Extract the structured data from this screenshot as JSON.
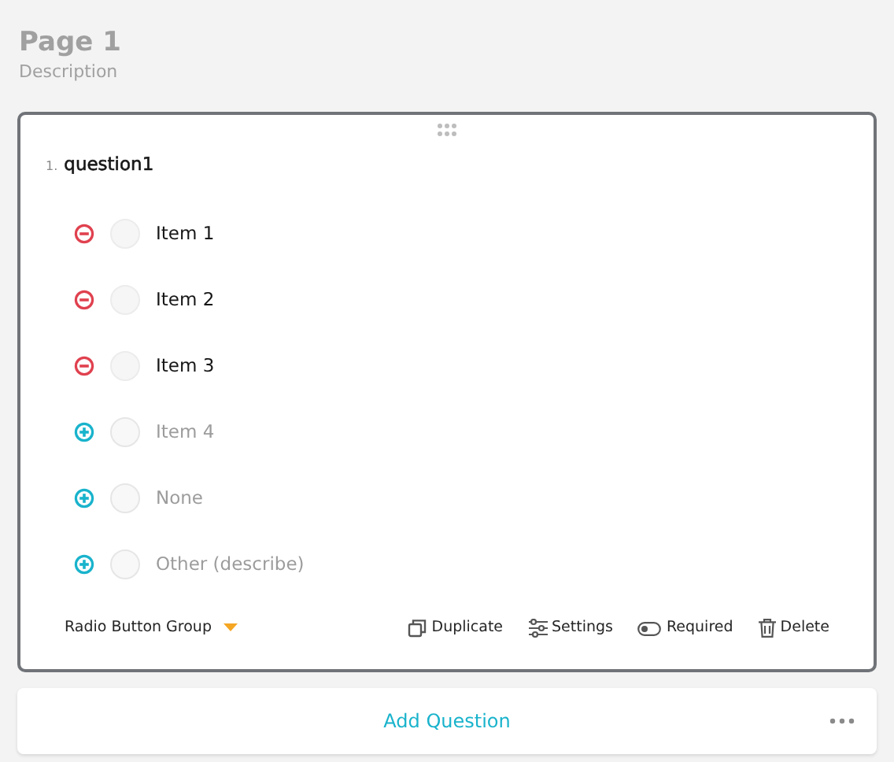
{
  "page": {
    "title": "Page 1",
    "description": "Description"
  },
  "question": {
    "number": "1.",
    "title": "question1",
    "choices": [
      {
        "kind": "choice",
        "label": "Item 1",
        "selected": false
      },
      {
        "kind": "choice",
        "label": "Item 2",
        "selected": false
      },
      {
        "kind": "choice",
        "label": "Item 3",
        "selected": false
      },
      {
        "kind": "extra",
        "label": "Item 4",
        "selected": false
      },
      {
        "kind": "extra",
        "label": "None",
        "selected": false
      },
      {
        "kind": "extra",
        "label": "Other (describe)",
        "selected": false
      }
    ],
    "type": "Radio Button Group",
    "actions": [
      {
        "kind": "duplicate",
        "label": "Duplicate"
      },
      {
        "kind": "settings",
        "label": "Settings"
      },
      {
        "kind": "required",
        "label": "Required"
      },
      {
        "kind": "delete",
        "label": "Delete"
      }
    ]
  },
  "add_question": {
    "label": "Add Question"
  }
}
